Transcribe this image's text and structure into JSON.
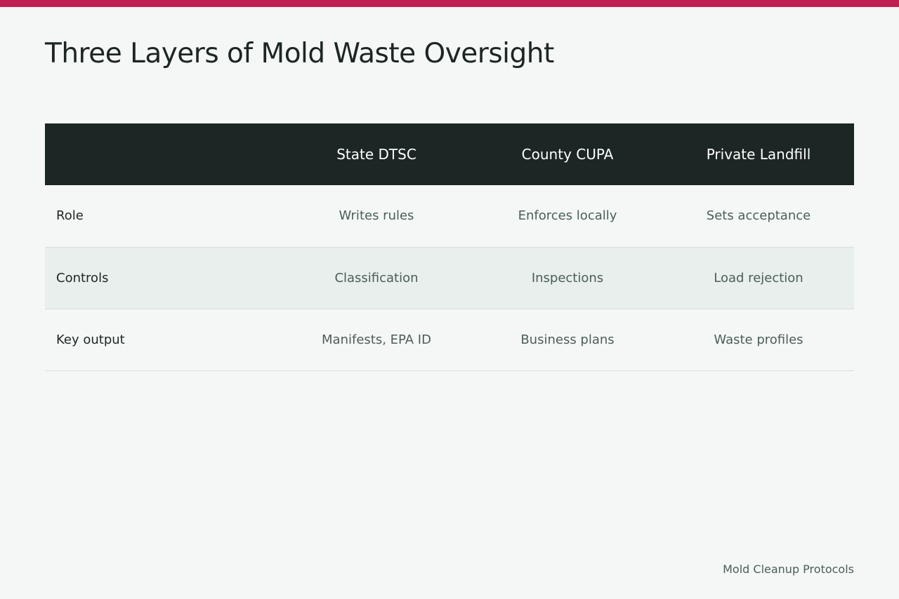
{
  "colors": {
    "accent_bar": "#c0204f",
    "header_background": "#1c2624",
    "page_background": "#f5f7f6",
    "striped_row": "#e8efec",
    "muted_text": "#4a5e58"
  },
  "title": "Three Layers of Mold Waste Oversight",
  "table": {
    "header": {
      "corner": "",
      "columns": [
        "State DTSC",
        "County CUPA",
        "Private Landfill"
      ]
    },
    "rows": [
      {
        "label": "Role",
        "cells": [
          "Writes rules",
          "Enforces locally",
          "Sets acceptance"
        ]
      },
      {
        "label": "Controls",
        "cells": [
          "Classification",
          "Inspections",
          "Load rejection"
        ]
      },
      {
        "label": "Key output",
        "cells": [
          "Manifests, EPA ID",
          "Business plans",
          "Waste profiles"
        ]
      }
    ]
  },
  "footer": {
    "credit": "Mold Cleanup Protocols"
  }
}
